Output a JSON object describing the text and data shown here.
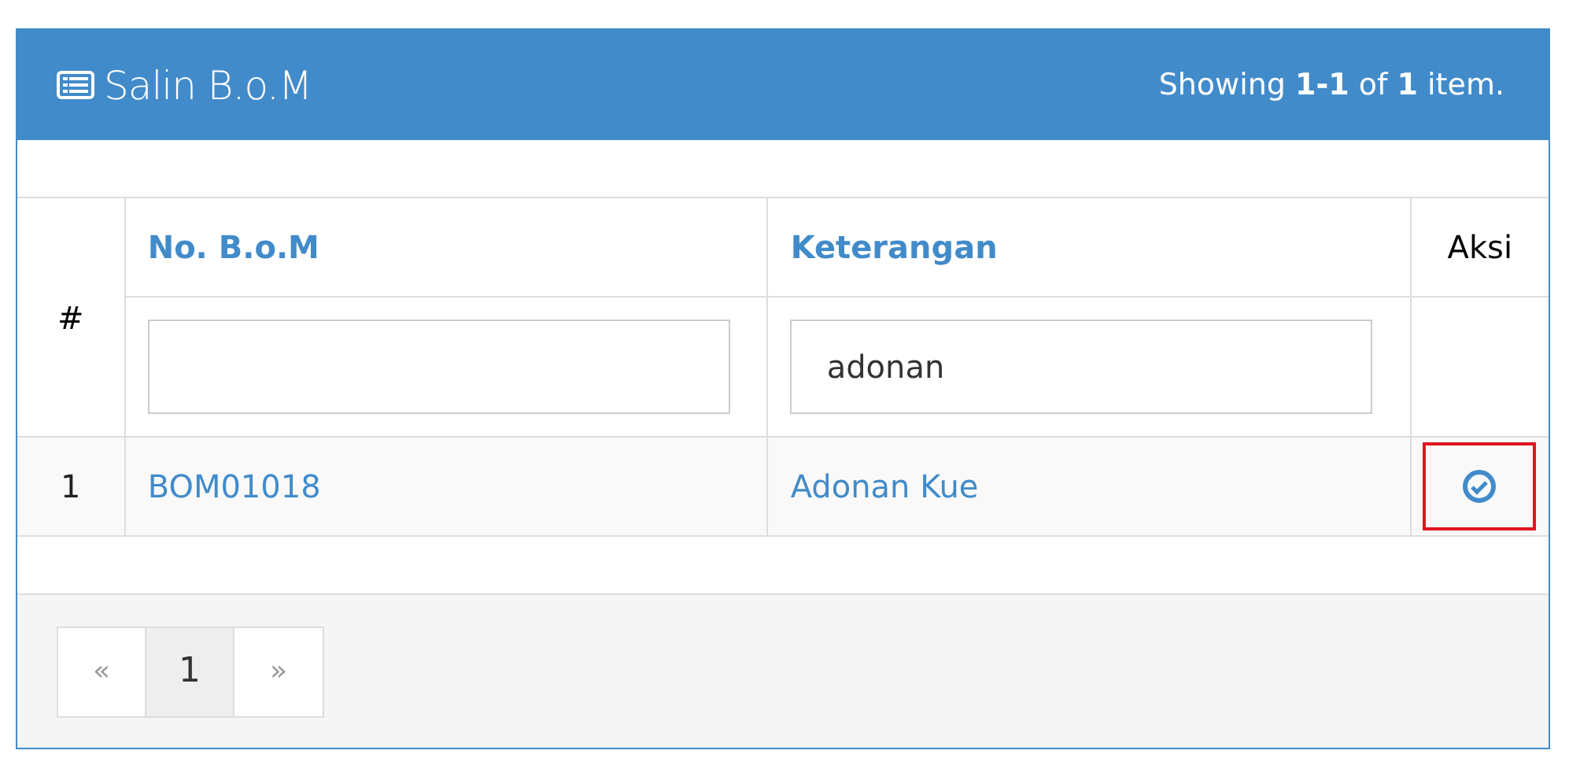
{
  "panel": {
    "title": "Salin B.o.M",
    "summary": "Showing **1-1** of **1** item."
  },
  "table": {
    "columns": [
      {
        "label": "#",
        "kind": "plain"
      },
      {
        "label": "No. B.o.M",
        "kind": "sort"
      },
      {
        "label": "Keterangan",
        "kind": "sort"
      },
      {
        "label": "Aksi",
        "kind": "plain"
      }
    ],
    "filters": [
      {
        "kind": "text"
      },
      {
        "kind": "text",
        "value": "adonan"
      }
    ],
    "rows": [
      {
        "number": "1",
        "no_bom": "BOM01018",
        "keterangan": "Adonan Kue",
        "action_highlighted": true
      }
    ]
  },
  "pagination": [
    {
      "label": "«",
      "kind": "prev",
      "selected": false
    },
    {
      "label": "1",
      "kind": "page",
      "selected": true
    },
    {
      "label": "»",
      "kind": "next",
      "selected": false
    }
  ]
}
